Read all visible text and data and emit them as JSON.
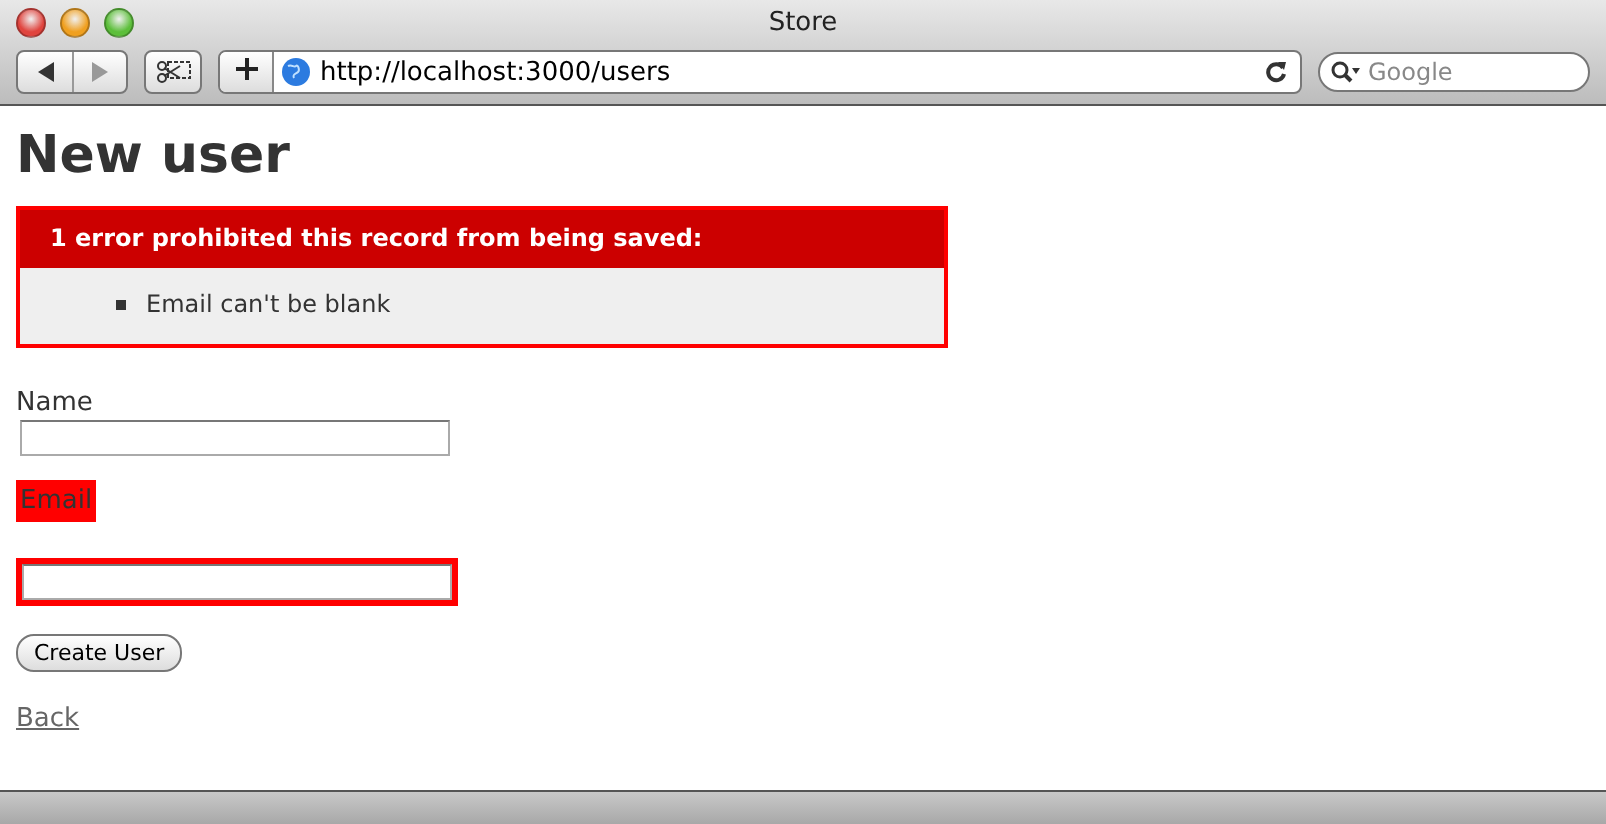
{
  "window": {
    "title": "Store"
  },
  "toolbar": {
    "url": "http://localhost:3000/users",
    "search_placeholder": "Google"
  },
  "page": {
    "heading": "New user",
    "error_box": {
      "title": "1 error prohibited this record from being saved:",
      "messages": [
        "Email can't be blank"
      ]
    },
    "fields": [
      {
        "label": "Name",
        "error": false
      },
      {
        "label": "Email",
        "error": true
      }
    ],
    "submit": "Create User",
    "back_link": "Back"
  }
}
